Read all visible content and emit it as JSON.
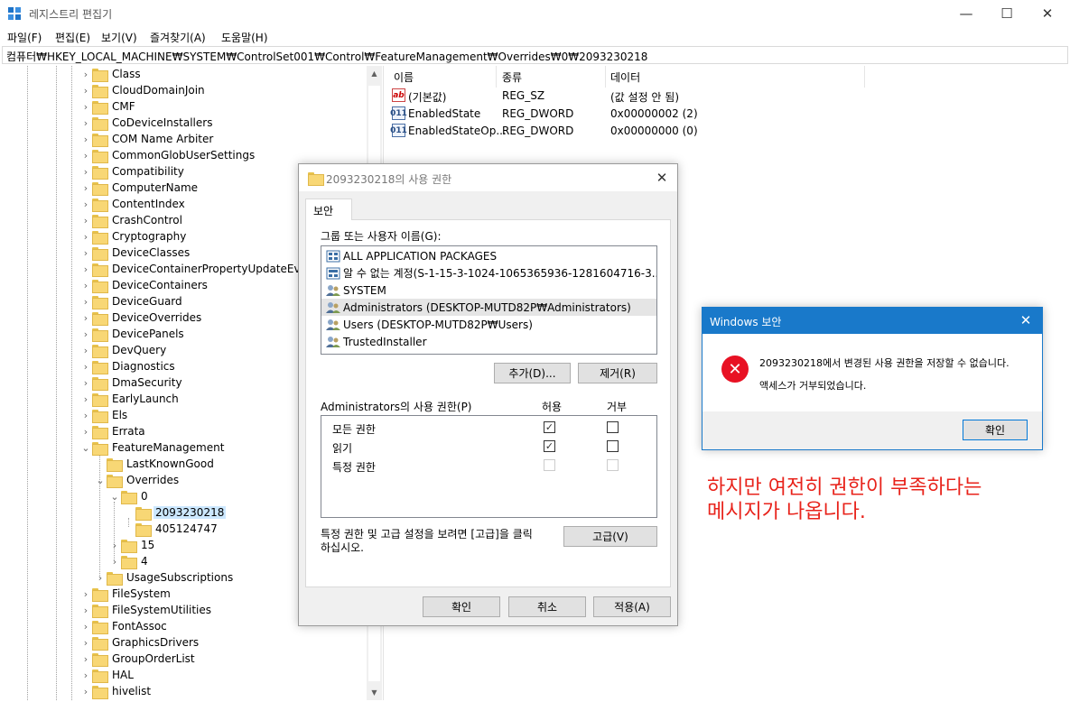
{
  "window": {
    "title": "레지스트리 편집기",
    "minimize": "—",
    "maximize": "☐",
    "close": "✕"
  },
  "menu": [
    "파일(F)",
    "편집(E)",
    "보기(V)",
    "즐겨찾기(A)",
    "도움말(H)"
  ],
  "address": "컴퓨터₩HKEY_LOCAL_MACHINE₩SYSTEM₩ControlSet001₩Control₩FeatureManagement₩Overrides₩0₩2093230218",
  "tree": [
    "Class",
    "CloudDomainJoin",
    "CMF",
    "CoDeviceInstallers",
    "COM Name Arbiter",
    "CommonGlobUserSettings",
    "Compatibility",
    "ComputerName",
    "ContentIndex",
    "CrashControl",
    "Cryptography",
    "DeviceClasses",
    "DeviceContainerPropertyUpdateEvents",
    "DeviceContainers",
    "DeviceGuard",
    "DeviceOverrides",
    "DevicePanels",
    "DevQuery",
    "Diagnostics",
    "DmaSecurity",
    "EarlyLaunch",
    "Els",
    "Errata",
    "FeatureManagement",
    "LastKnownGood",
    "Overrides",
    "0",
    "2093230218",
    "405124747",
    "15",
    "4",
    "UsageSubscriptions",
    "FileSystem",
    "FileSystemUtilities",
    "FontAssoc",
    "GraphicsDrivers",
    "GroupOrderList",
    "HAL",
    "hivelist"
  ],
  "values_header": {
    "name": "이름",
    "type": "종류",
    "data": "데이터"
  },
  "values": [
    {
      "icon": "ab",
      "name": "(기본값)",
      "type": "REG_SZ",
      "data": "(값 설정 안 됨)"
    },
    {
      "icon": "011",
      "name": "EnabledState",
      "type": "REG_DWORD",
      "data": "0x00000002 (2)"
    },
    {
      "icon": "011",
      "name": "EnabledStateOp...",
      "type": "REG_DWORD",
      "data": "0x00000000 (0)"
    }
  ],
  "perm_dialog": {
    "title": "2093230218의 사용 권한",
    "close": "✕",
    "tab": "보안",
    "group_label": "그룹 또는 사용자 이름(G):",
    "users": [
      "ALL APPLICATION PACKAGES",
      "알 수 없는 계정(S-1-15-3-1024-1065365936-1281604716-3...",
      "SYSTEM",
      "Administrators (DESKTOP-MUTD82P₩Administrators)",
      "Users (DESKTOP-MUTD82P₩Users)",
      "TrustedInstaller"
    ],
    "add_button": "추가(D)...",
    "remove_button": "제거(R)",
    "perm_label": "Administrators의 사용 권한(P)",
    "allow_header": "허용",
    "deny_header": "거부",
    "permissions": [
      {
        "name": "모든 권한",
        "allow": true,
        "deny": false,
        "disabled": false
      },
      {
        "name": "읽기",
        "allow": true,
        "deny": false,
        "disabled": false
      },
      {
        "name": "특정 권한",
        "allow": false,
        "deny": false,
        "disabled": true
      }
    ],
    "advanced_text_1": "특정 권한 및 고급 설정을 보려면 [고급]을 클릭",
    "advanced_text_2": "하십시오.",
    "advanced_button": "고급(V)",
    "ok": "확인",
    "cancel": "취소",
    "apply": "적용(A)"
  },
  "msgbox": {
    "title": "Windows 보안",
    "close": "✕",
    "line1": "2093230218에서 변경된 사용 권한을 저장할 수 없습니다.",
    "line2": "액세스가 거부되었습니다.",
    "ok": "확인"
  },
  "annotation": {
    "line1": "하지만 여전히 권한이 부족하다는",
    "line2": "메시지가 나옵니다."
  },
  "colors": {
    "selection": "#cce8ff",
    "msg_title": "#1979ca",
    "error": "#e81123",
    "annotation": "#e8231b"
  }
}
